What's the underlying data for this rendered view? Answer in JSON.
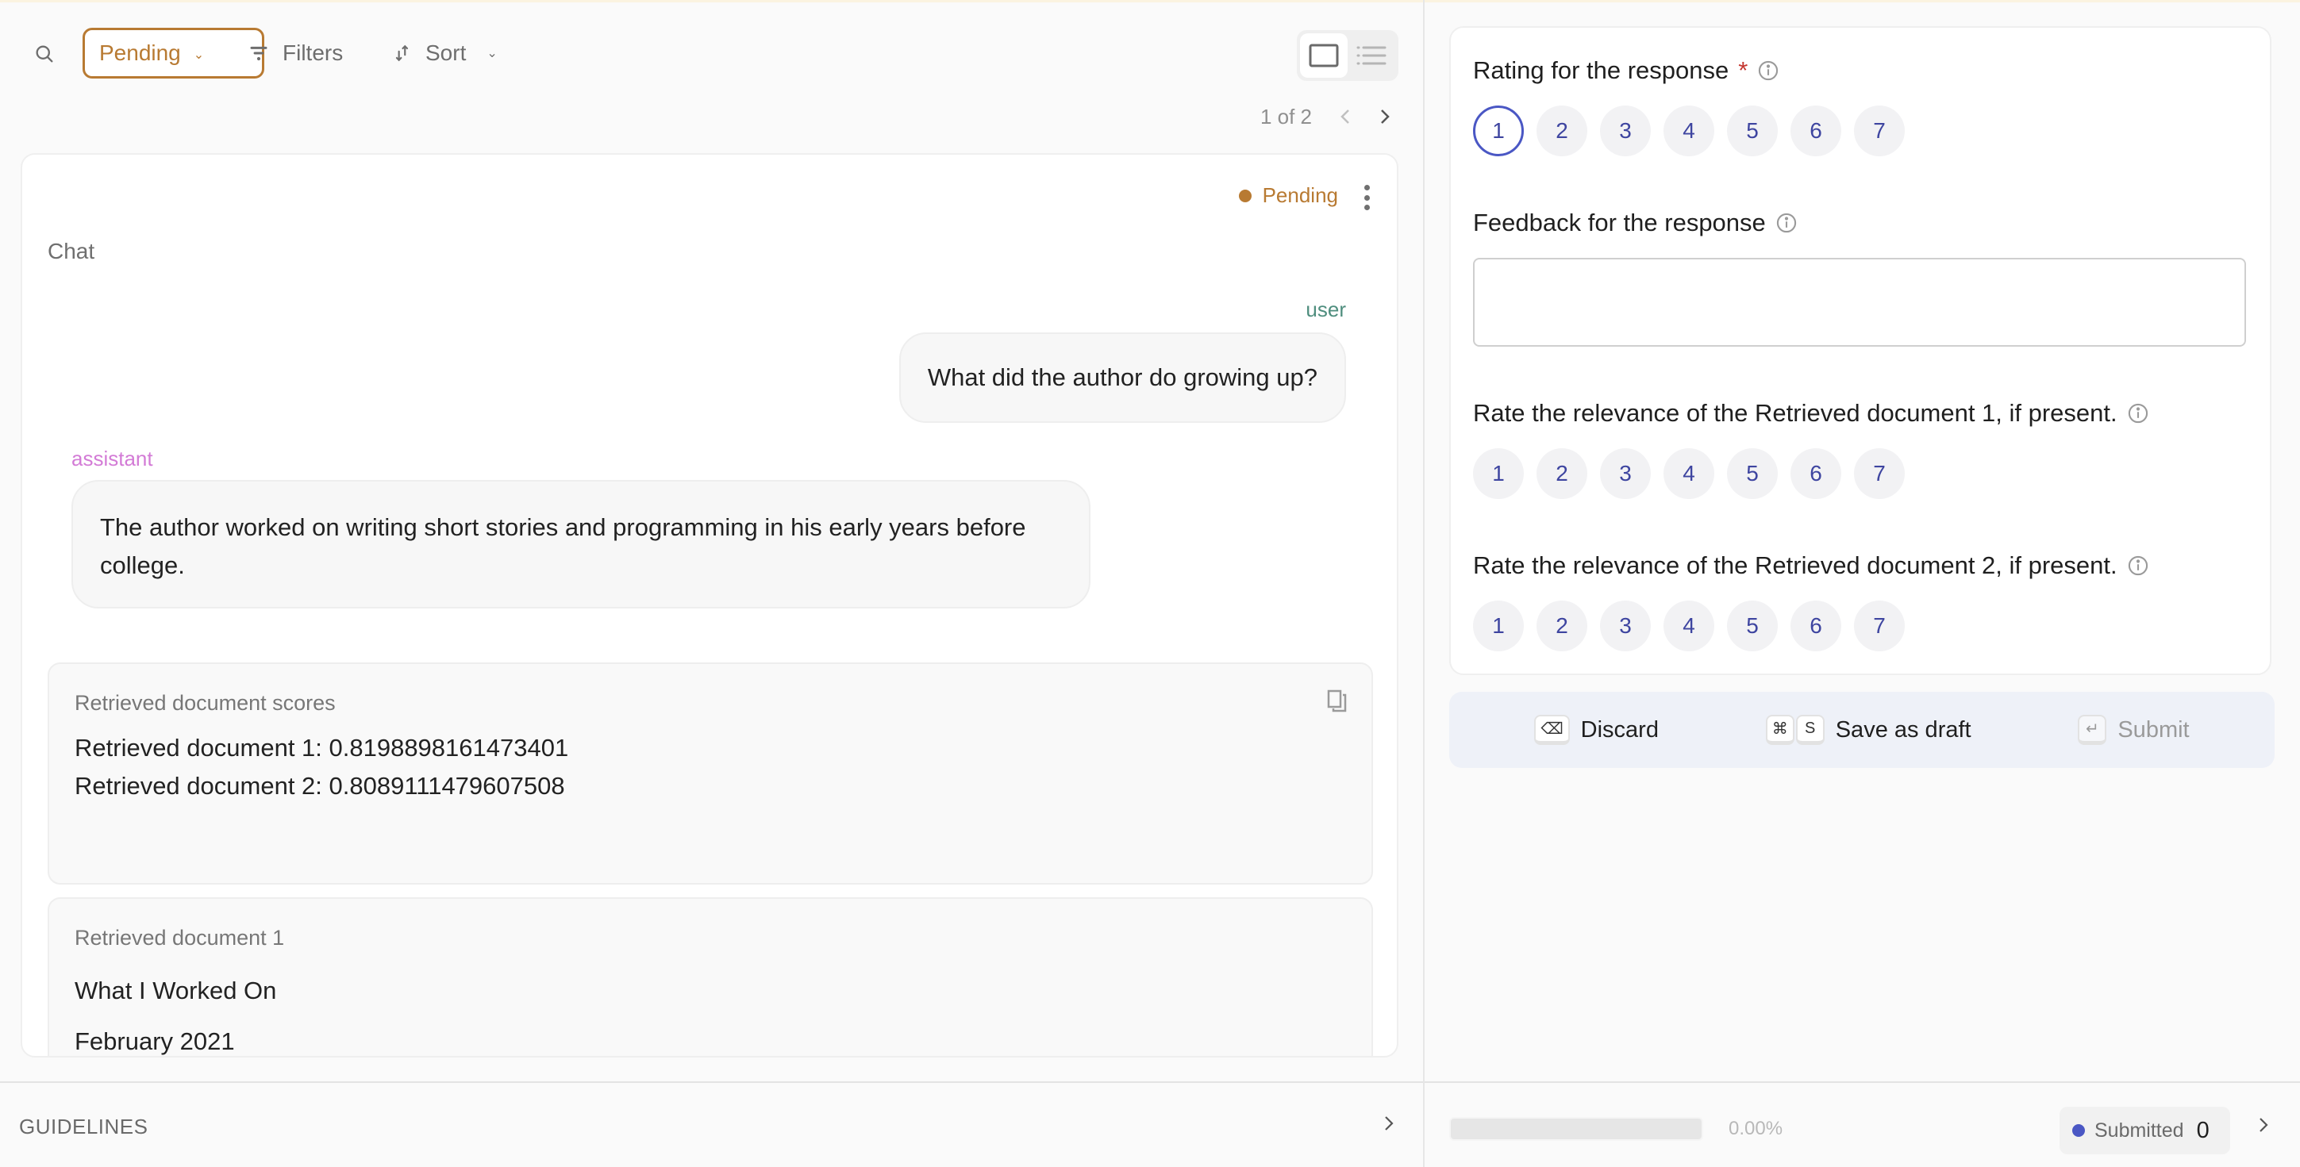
{
  "toolbar": {
    "search_icon": "search-icon",
    "status_filter": {
      "selected": "Pending",
      "icon": "chevron-down-icon"
    },
    "filters_label": "Filters",
    "sort_label": "Sort",
    "view_modes": [
      "single-record",
      "list"
    ],
    "active_view": "single-record"
  },
  "pagination": {
    "text": "1 of 2",
    "current": 1,
    "total": 2
  },
  "record": {
    "status": "Pending",
    "status_color": "#b87a32",
    "field_title": "Chat",
    "messages": [
      {
        "role": "user",
        "content": "What did the author do growing up?"
      },
      {
        "role": "assistant",
        "content": "The author worked on writing short stories and programming in his early years before college."
      }
    ],
    "retrieved_scores": {
      "label": "Retrieved document scores",
      "lines": [
        "Retrieved document 1: 0.8198898161473401",
        "Retrieved document 2: 0.8089111479607508"
      ]
    },
    "retrieved_doc_1": {
      "label": "Retrieved document 1",
      "lines": [
        "What I Worked On",
        "February 2021"
      ]
    }
  },
  "guidelines": {
    "label": "GUIDELINES"
  },
  "questions": {
    "rating": {
      "label": "Rating for the response",
      "required_mark": "*",
      "options": [
        "1",
        "2",
        "3",
        "4",
        "5",
        "6",
        "7"
      ],
      "selected": "1"
    },
    "feedback": {
      "label": "Feedback for the response",
      "value": "",
      "placeholder": ""
    },
    "doc1_relevance": {
      "label": "Rate the relevance of the Retrieved document 1, if present.",
      "options": [
        "1",
        "2",
        "3",
        "4",
        "5",
        "6",
        "7"
      ],
      "selected": null
    },
    "doc2_relevance": {
      "label": "Rate the relevance of the Retrieved document 2, if present.",
      "options": [
        "1",
        "2",
        "3",
        "4",
        "5",
        "6",
        "7"
      ],
      "selected": null
    }
  },
  "actions": {
    "discard": {
      "label": "Discard",
      "shortcut": "⌫"
    },
    "save_draft": {
      "label": "Save as draft",
      "shortcut": [
        "⌘",
        "S"
      ]
    },
    "submit": {
      "label": "Submit",
      "shortcut": "↵",
      "disabled": true
    }
  },
  "progress": {
    "percent": 0,
    "text": "0.00%",
    "submitted_label": "Submitted",
    "submitted_count": "0",
    "accent": "#4a57c4"
  }
}
